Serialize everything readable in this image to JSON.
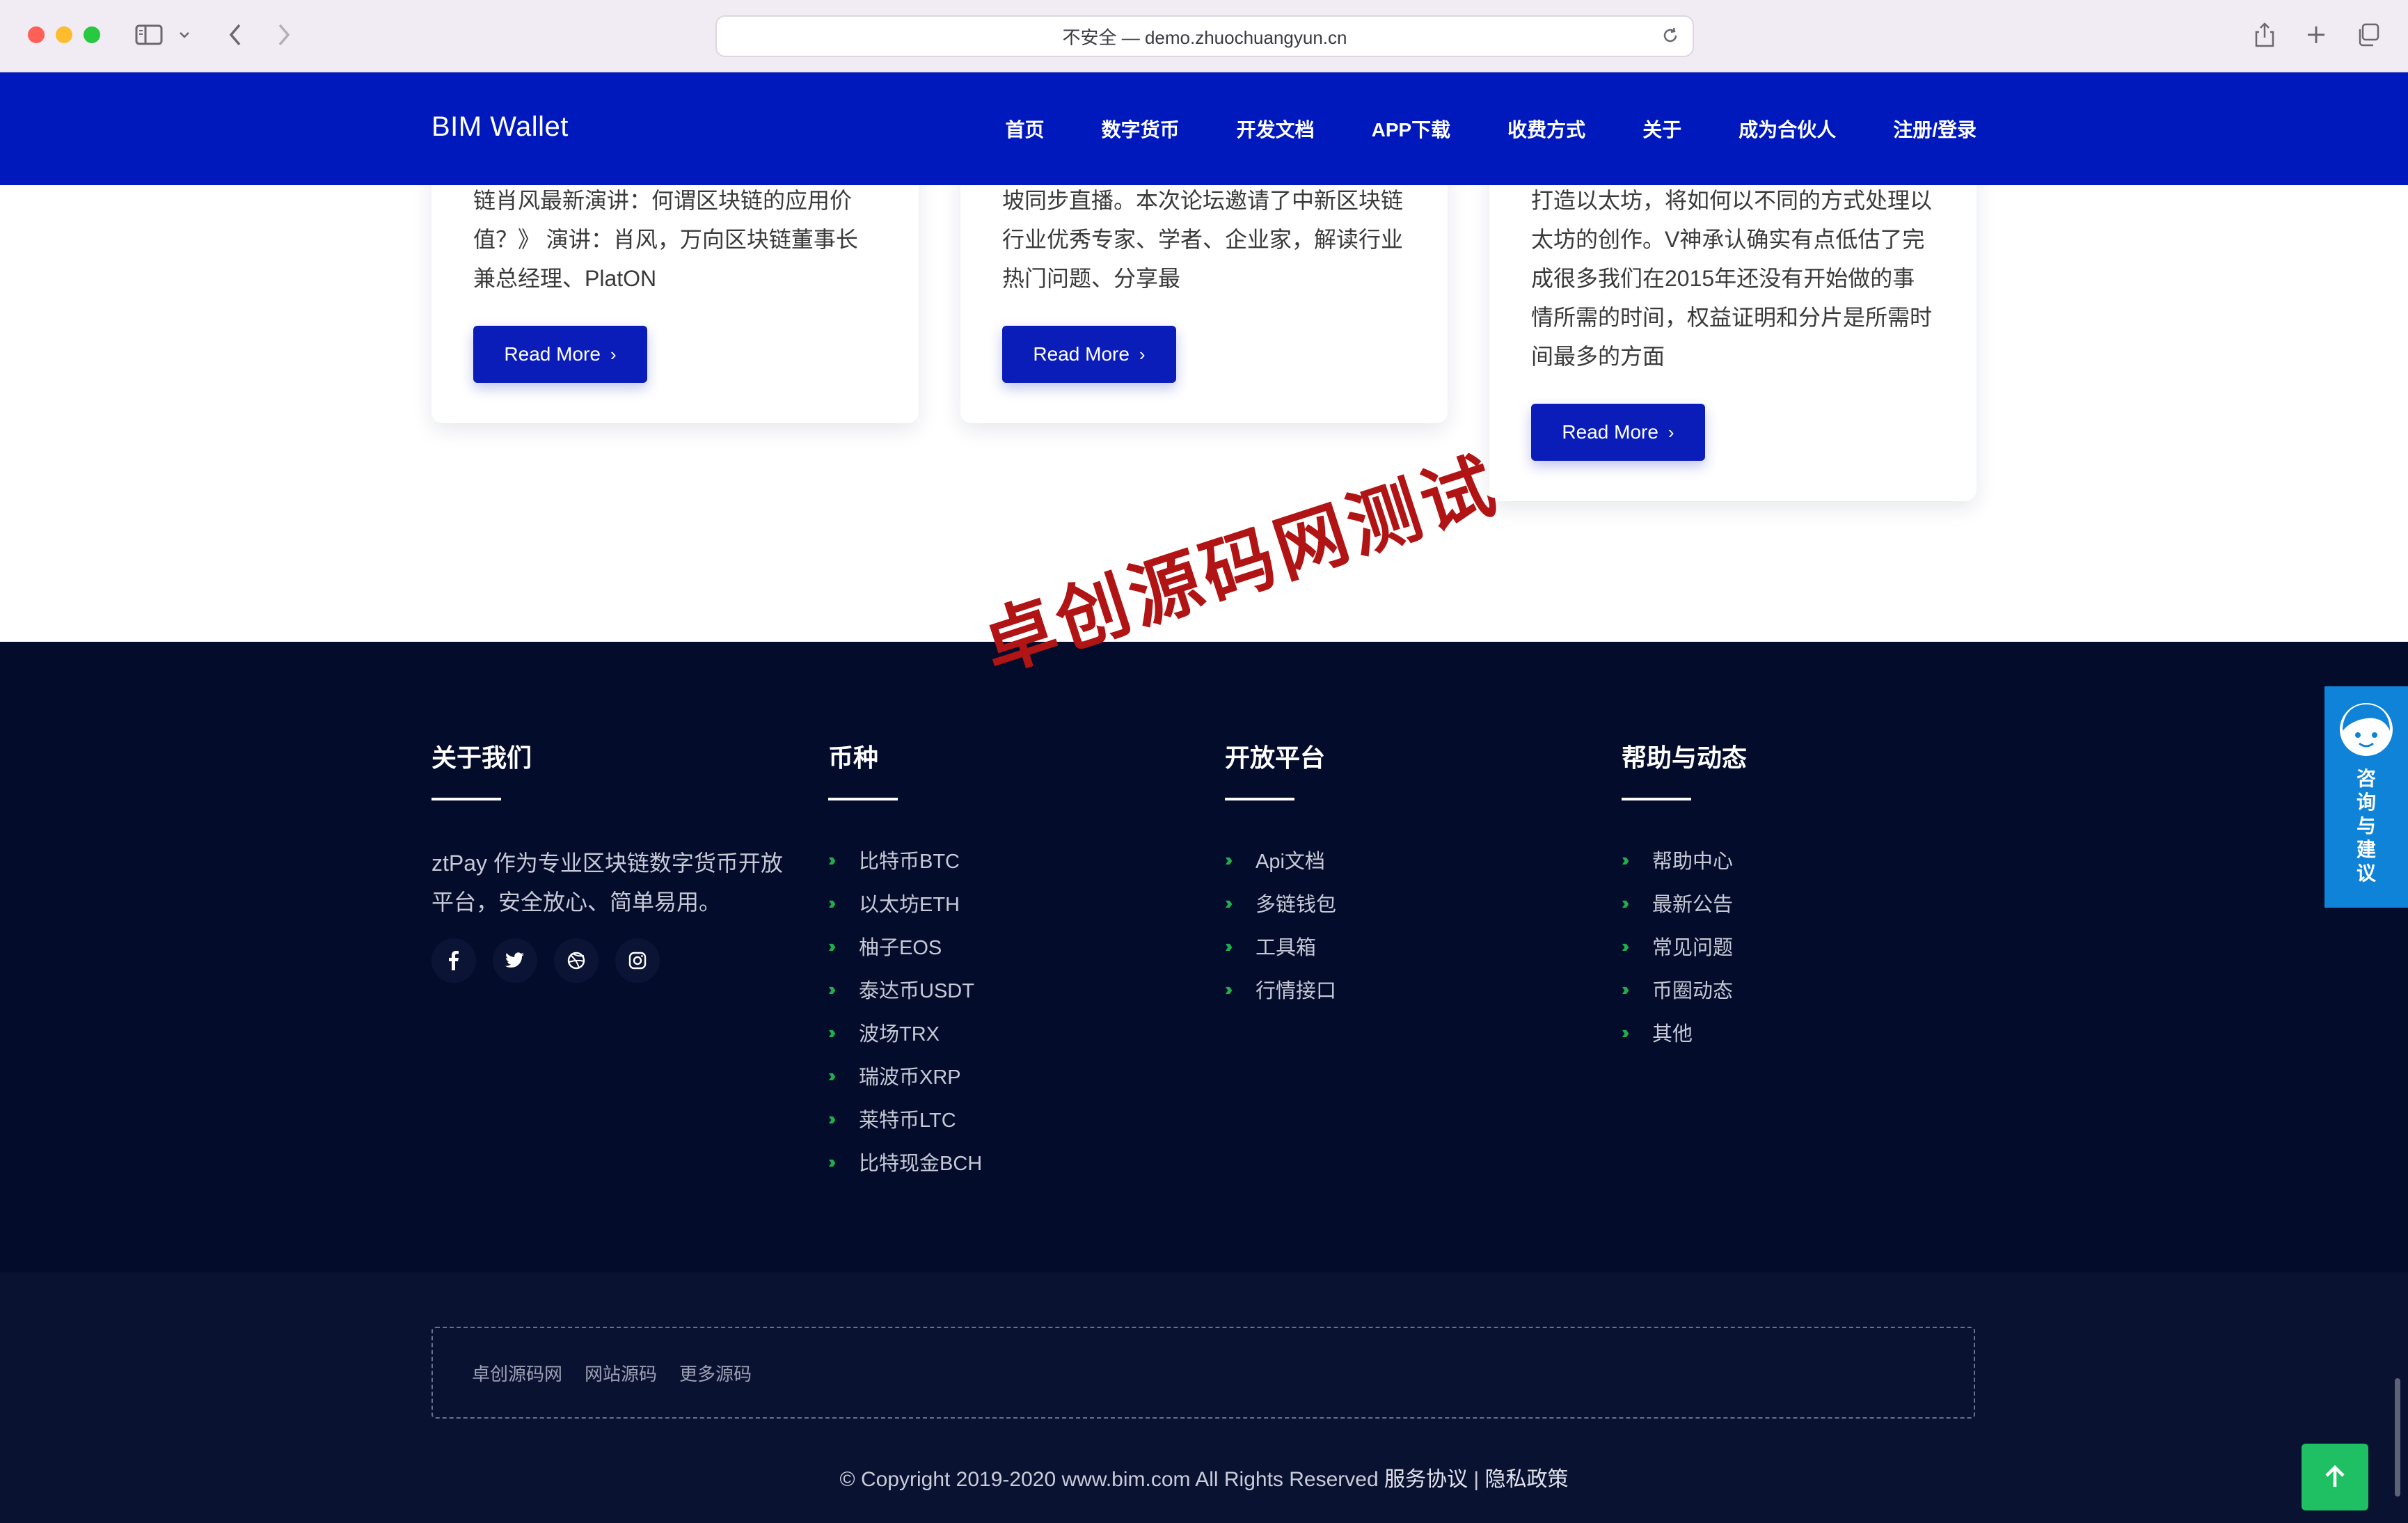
{
  "browser": {
    "url_text": "不安全 — demo.zhuochuangyun.cn",
    "icons": [
      "sidebar-icon",
      "chevron-down-icon",
      "back-arrow-icon",
      "forward-arrow-icon",
      "reload-icon",
      "share-icon",
      "plus-icon",
      "tabs-icon"
    ]
  },
  "nav": {
    "brand": "BIM Wallet",
    "items": [
      "首页",
      "数字货币",
      "开发文档",
      "APP下载",
      "收费方式",
      "关于",
      "成为合伙人",
      "注册/登录"
    ]
  },
  "cards": [
    {
      "lines": [
        "链肖风最新演讲：何谓区块链的应用价",
        "值？》 演讲：肖风，万向区块链董事长",
        "兼总经理、PlatON"
      ],
      "button": "Read More"
    },
    {
      "lines": [
        "坡同步直播。本次论坛邀请了中新区块链",
        "行业优秀专家、学者、企业家，解读行业",
        "热门问题、分享最"
      ],
      "button": "Read More"
    },
    {
      "lines": [
        "打造以太坊，将如何以不同的方式处理以",
        "太坊的创作。V神承认确实有点低估了完",
        "成很多我们在2015年还没有开始做的事",
        "情所需的时间，权益证明和分片是所需时",
        "间最多的方面"
      ],
      "button": "Read More"
    }
  ],
  "watermark": "卓创源码网测试",
  "footer": {
    "about": {
      "title": "关于我们",
      "text": "ztPay 作为专业区块链数字货币开放平台，安全放心、简单易用。",
      "socials": [
        "facebook-icon",
        "twitter-icon",
        "dribbble-icon",
        "instagram-icon"
      ]
    },
    "coins": {
      "title": "币种",
      "items": [
        "比特币BTC",
        "以太坊ETH",
        "柚子EOS",
        "泰达币USDT",
        "波场TRX",
        "瑞波币XRP",
        "莱特币LTC",
        "比特现金BCH"
      ]
    },
    "platform": {
      "title": "开放平台",
      "items": [
        "Api文档",
        "多链钱包",
        "工具箱",
        "行情接口"
      ]
    },
    "help": {
      "title": "帮助与动态",
      "items": [
        "帮助中心",
        "最新公告",
        "常见问题",
        "币圈动态",
        "其他"
      ]
    },
    "friend_links": [
      "卓创源码网",
      "网站源码",
      "更多源码"
    ],
    "copyright": "© Copyright 2019-2020 www.bim.com All Rights Reserved",
    "terms": "服务协议",
    "separator": "|",
    "privacy": "隐私政策"
  },
  "widgets": {
    "consult_text": [
      "咨",
      "询",
      "与",
      "建",
      "议"
    ],
    "back_to_top_icon": "arrow-up-icon",
    "colors": {
      "nav": "#0019bd",
      "footer": "#030c2b",
      "accent_green": "#1fae4d",
      "consult": "#0f83d8",
      "back_top": "#1fc063"
    }
  }
}
